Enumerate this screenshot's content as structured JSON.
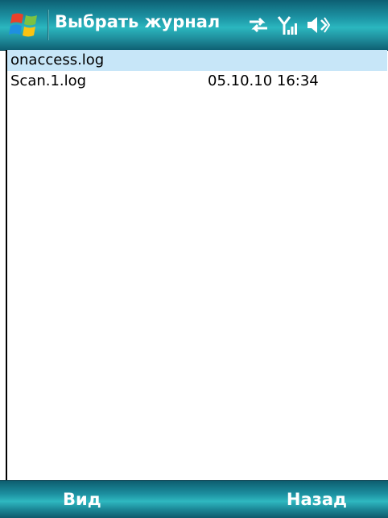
{
  "title_bar": {
    "title": "Выбрать журнал",
    "start_icon": "windows-flag-icon",
    "status_icons": [
      "connectivity-arrows-icon",
      "signal-strength-icon",
      "volume-icon"
    ]
  },
  "file_list": [
    {
      "name": "onaccess.log",
      "date": "",
      "selected": true
    },
    {
      "name": "Scan.1.log",
      "date": "05.10.10 16:34",
      "selected": false
    }
  ],
  "softkeys": {
    "left": "Вид",
    "right": "Назад"
  },
  "colors": {
    "bar_teal": "#1e98a8",
    "selection": "#c7e6f8"
  }
}
